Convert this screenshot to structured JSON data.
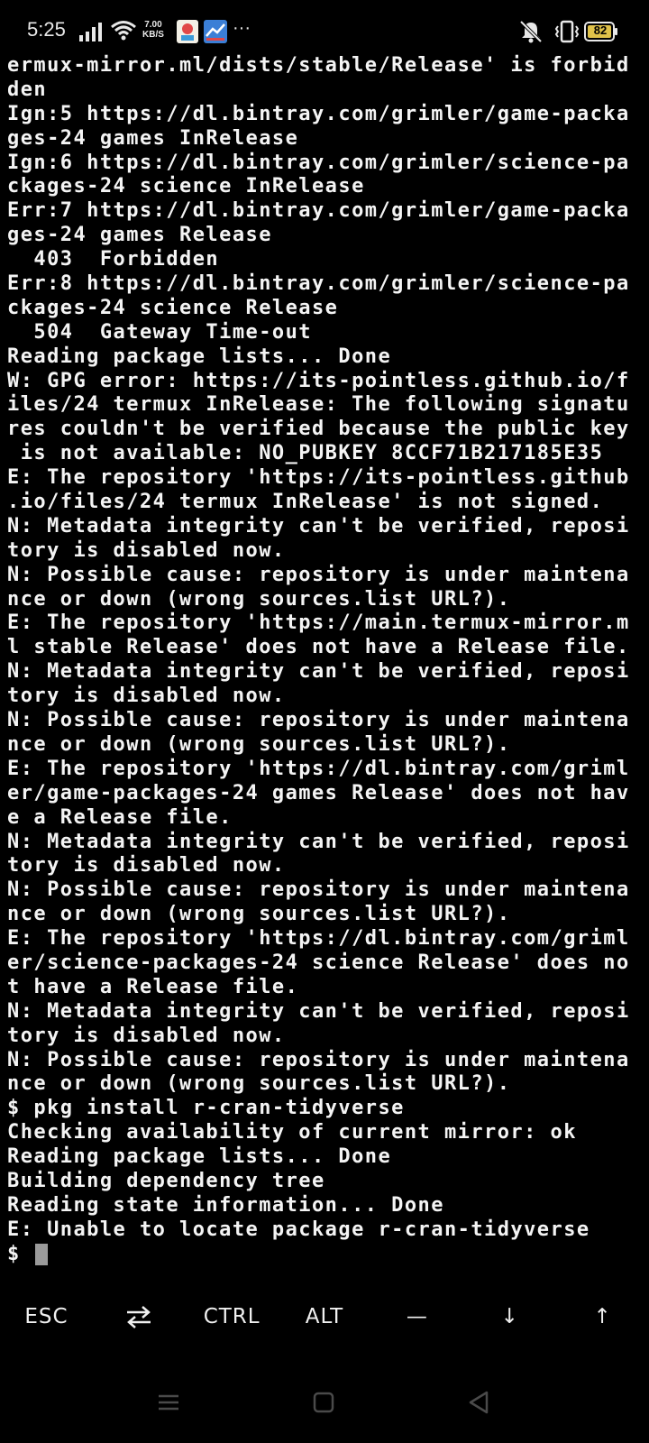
{
  "status_bar": {
    "time": "5:25",
    "network_speed_value": "7.00",
    "network_speed_unit": "KB/S",
    "more_indicator": "···",
    "battery_level": "82",
    "icons": [
      "signal-icon",
      "wifi-icon",
      "notification-app-icon",
      "notification-app-icon",
      "mute-icon",
      "vibrate-icon",
      "battery-icon"
    ],
    "battery_color": "#e0c24a"
  },
  "terminal": {
    "lines": [
      "ermux-mirror.ml/dists/stable/Release' is forbid",
      "den",
      "Ign:5 https://dl.bintray.com/grimler/game-packa",
      "ges-24 games InRelease",
      "Ign:6 https://dl.bintray.com/grimler/science-pa",
      "ckages-24 science InRelease",
      "Err:7 https://dl.bintray.com/grimler/game-packa",
      "ges-24 games Release",
      "  403  Forbidden",
      "Err:8 https://dl.bintray.com/grimler/science-pa",
      "ckages-24 science Release",
      "  504  Gateway Time-out",
      "Reading package lists... Done",
      "W: GPG error: https://its-pointless.github.io/f",
      "iles/24 termux InRelease: The following signatu",
      "res couldn't be verified because the public key",
      " is not available: NO_PUBKEY 8CCF71B217185E35",
      "E: The repository 'https://its-pointless.github",
      ".io/files/24 termux InRelease' is not signed.",
      "N: Metadata integrity can't be verified, reposi",
      "tory is disabled now.",
      "N: Possible cause: repository is under maintena",
      "nce or down (wrong sources.list URL?).",
      "E: The repository 'https://main.termux-mirror.m",
      "l stable Release' does not have a Release file.",
      "N: Metadata integrity can't be verified, reposi",
      "tory is disabled now.",
      "N: Possible cause: repository is under maintena",
      "nce or down (wrong sources.list URL?).",
      "E: The repository 'https://dl.bintray.com/griml",
      "er/game-packages-24 games Release' does not hav",
      "e a Release file.",
      "N: Metadata integrity can't be verified, reposi",
      "tory is disabled now.",
      "N: Possible cause: repository is under maintena",
      "nce or down (wrong sources.list URL?).",
      "E: The repository 'https://dl.bintray.com/griml",
      "er/science-packages-24 science Release' does no",
      "t have a Release file.",
      "N: Metadata integrity can't be verified, reposi",
      "tory is disabled now.",
      "N: Possible cause: repository is under maintena",
      "nce or down (wrong sources.list URL?).",
      "$ pkg install r-cran-tidyverse",
      "Checking availability of current mirror: ok",
      "Reading package lists... Done",
      "Building dependency tree",
      "Reading state information... Done",
      "E: Unable to locate package r-cran-tidyverse"
    ],
    "prompt": "$ ",
    "background_color": "#000000",
    "text_color": "#f4f4f4"
  },
  "extra_keys": {
    "esc": "ESC",
    "tab_icon": "tab-arrows-icon",
    "ctrl": "CTRL",
    "alt": "ALT",
    "dash": "—",
    "down": "↓",
    "up": "↑"
  },
  "nav_bar": {
    "icons": [
      "menu-icon",
      "home-icon",
      "back-icon"
    ]
  }
}
